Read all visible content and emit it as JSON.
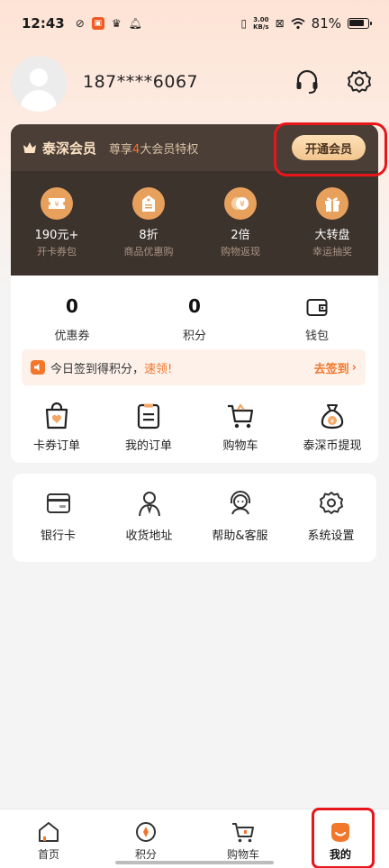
{
  "status_bar": {
    "time": "12:43",
    "speed_value": "3.00",
    "speed_unit": "KB/s",
    "battery": "81%"
  },
  "profile": {
    "phone": "187****6067"
  },
  "membership": {
    "name": "泰深会员",
    "privilege_prefix": "尊享",
    "privilege_count": "4",
    "privilege_suffix": "大会员特权",
    "open_button": "开通会员",
    "benefits": [
      {
        "value": "190元+",
        "desc": "开卡券包",
        "icon": "ticket-icon"
      },
      {
        "value": "8折",
        "desc": "商品优惠购",
        "icon": "price-tag-icon"
      },
      {
        "value": "2倍",
        "desc": "购物返现",
        "icon": "coin-cashback-icon"
      },
      {
        "value": "大转盘",
        "desc": "幸运抽奖",
        "icon": "gift-box-icon"
      }
    ]
  },
  "assets": {
    "coupons": {
      "value": "0",
      "label": "优惠券"
    },
    "points": {
      "value": "0",
      "label": "积分"
    },
    "wallet": {
      "label": "钱包"
    }
  },
  "checkin": {
    "text": "今日签到得积分，",
    "highlight": "速领!",
    "link": "去签到"
  },
  "orders": [
    {
      "label": "卡券订单",
      "icon": "card-order-icon"
    },
    {
      "label": "我的订单",
      "icon": "order-list-icon"
    },
    {
      "label": "购物车",
      "icon": "shopping-cart-icon"
    },
    {
      "label": "泰深币提现",
      "icon": "money-bag-icon"
    }
  ],
  "services": [
    {
      "label": "银行卡",
      "icon": "bank-card-icon"
    },
    {
      "label": "收货地址",
      "icon": "address-icon"
    },
    {
      "label": "帮助&客服",
      "icon": "customer-service-icon"
    },
    {
      "label": "系统设置",
      "icon": "settings-icon"
    }
  ],
  "bottom_nav": [
    {
      "label": "首页",
      "icon": "home-icon"
    },
    {
      "label": "积分",
      "icon": "points-icon"
    },
    {
      "label": "购物车",
      "icon": "cart-icon"
    },
    {
      "label": "我的",
      "icon": "profile-icon",
      "active": true
    }
  ],
  "colors": {
    "accent": "#f2772b",
    "member_dark": "#3d332d",
    "gold": "#f2c58e",
    "annotation": "#e8161b"
  }
}
